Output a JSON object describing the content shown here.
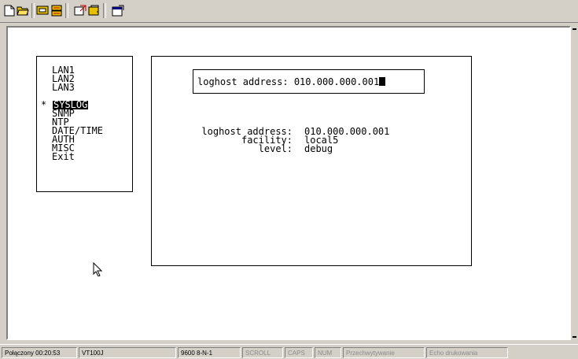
{
  "toolbar": {
    "buttons": [
      "new-icon",
      "open-icon",
      "connect-icon",
      "disconnect-icon",
      "send-icon",
      "receive-icon",
      "properties-icon"
    ]
  },
  "menu": {
    "items": [
      "LAN1",
      "LAN2",
      "LAN3",
      "SYSLOG",
      "SNMP",
      "NTP",
      "DATE/TIME",
      "AUTH",
      "MISC",
      "Exit"
    ],
    "selected_index": 3,
    "selected_marker": "*"
  },
  "input": {
    "label": "loghost address:",
    "value": "010.000.000.001"
  },
  "info": {
    "loghost_label": "loghost address:",
    "loghost_value": "010.000.000.001",
    "facility_label": "facility:",
    "facility_value": "local5",
    "level_label": "level:",
    "level_value": "debug"
  },
  "status": {
    "connected": "Połączony 00:20:53",
    "emulation": "VT100J",
    "port_settings": "9600 8-N-1",
    "scroll": "SCROLL",
    "caps": "CAPS",
    "num": "NUM",
    "capture": "Przechwytywanie",
    "print_echo": "Echo drukowania"
  }
}
